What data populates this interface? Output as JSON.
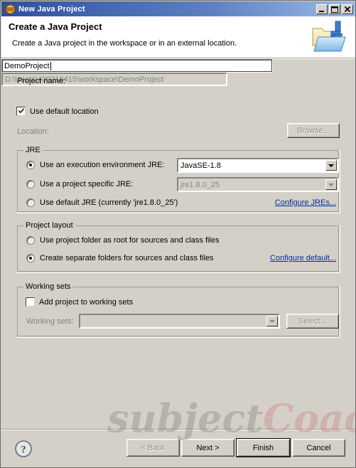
{
  "window": {
    "title": "New Java Project",
    "icon": "eclipse-wizard-icon",
    "controls": {
      "minimize": "minimize-button",
      "maximize": "maximize-button",
      "close": "close-button"
    }
  },
  "header": {
    "title": "Create a Java Project",
    "subtitle": "Create a Java project in the workspace or in an external location.",
    "icon": "java-project-folder-icon"
  },
  "project_name": {
    "label": "Project name:",
    "value": "DemoProject",
    "placeholder": ""
  },
  "location": {
    "use_default_label": "Use default location",
    "use_default_checked": true,
    "label": "Location:",
    "value": "D:\\Users\\400216415\\workspace\\DemoProject",
    "browse_label": "Browse...",
    "browse_enabled": false
  },
  "jre": {
    "group_label": "JRE",
    "options": [
      {
        "label": "Use an execution environment JRE:",
        "selected": true,
        "combo_value": "JavaSE-1.8",
        "combo_enabled": true
      },
      {
        "label": "Use a project specific JRE:",
        "selected": false,
        "combo_value": "jre1.8.0_25",
        "combo_enabled": false
      },
      {
        "label": "Use default JRE (currently 'jre1.8.0_25')",
        "selected": false
      }
    ],
    "configure_link": "Configure JREs..."
  },
  "project_layout": {
    "group_label": "Project layout",
    "options": [
      {
        "label": "Use project folder as root for sources and class files",
        "selected": false
      },
      {
        "label": "Create separate folders for sources and class files",
        "selected": true
      }
    ],
    "configure_link": "Configure default..."
  },
  "working_sets": {
    "group_label": "Working sets",
    "add_label": "Add project to working sets",
    "add_checked": false,
    "label": "Working sets:",
    "value": "",
    "select_label": "Select...",
    "select_enabled": false
  },
  "footer": {
    "help_icon": "help-question-icon",
    "buttons": [
      {
        "label": "< Back",
        "enabled": false,
        "default": false
      },
      {
        "label": "Next >",
        "enabled": true,
        "default": false
      },
      {
        "label": "Finish",
        "enabled": true,
        "default": true
      },
      {
        "label": "Cancel",
        "enabled": true,
        "default": false
      }
    ]
  },
  "watermark": {
    "part1": "subject",
    "part2": "Coach"
  },
  "colors": {
    "dialog_bg": "#d4d0c8",
    "titlebar_start": "#2f4f9e",
    "titlebar_end": "#9cbce6",
    "link": "#00309c",
    "disabled_text": "#848280",
    "header_bg": "#ffffff"
  }
}
